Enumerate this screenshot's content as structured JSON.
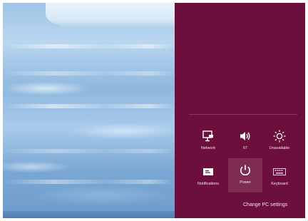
{
  "panel": {
    "bg_color": "#6d0f3c",
    "quick_settings": [
      {
        "label": "Network",
        "icon": "network-icon"
      },
      {
        "label": "67",
        "icon": "volume-icon"
      },
      {
        "label": "Unavailable",
        "icon": "brightness-icon"
      },
      {
        "label": "Notifications",
        "icon": "notifications-icon"
      },
      {
        "label": "Power",
        "icon": "power-icon"
      },
      {
        "label": "Keyboard",
        "icon": "keyboard-icon"
      }
    ],
    "change_pc_settings": "Change PC settings"
  },
  "desktop": {
    "wallpaper": "icy-water-wallpaper"
  }
}
